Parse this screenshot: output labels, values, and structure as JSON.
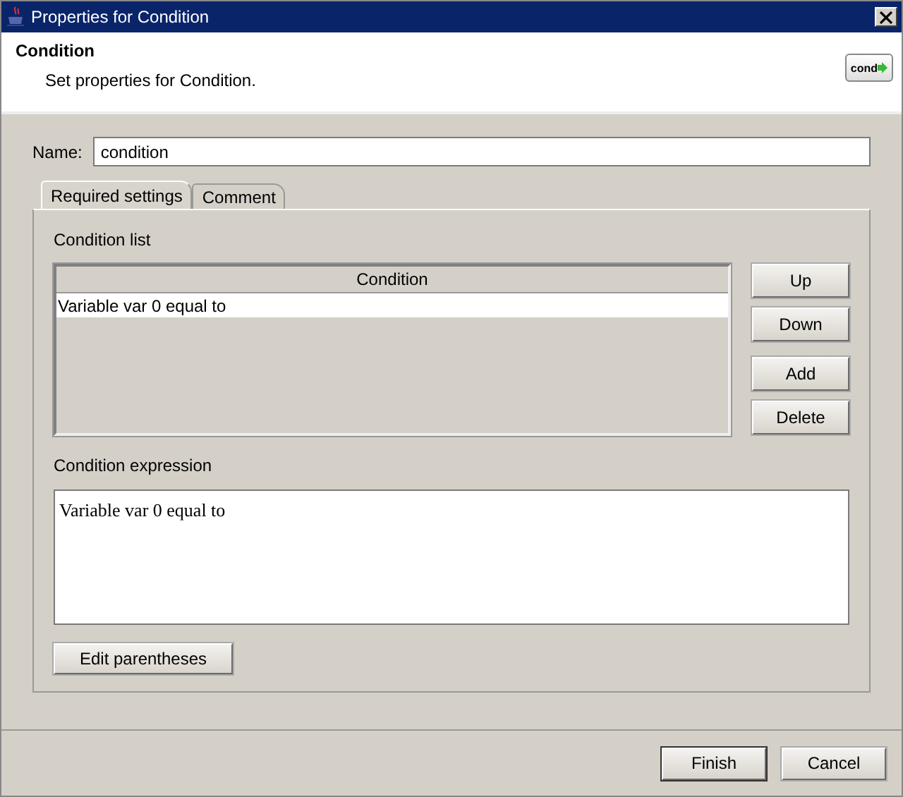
{
  "window": {
    "title": "Properties for Condition"
  },
  "header": {
    "title": "Condition",
    "description": "Set properties for Condition.",
    "badge": "cond"
  },
  "name_field": {
    "label": "Name:",
    "value": "condition"
  },
  "tabs": [
    {
      "label": "Required settings",
      "selected": true
    },
    {
      "label": "Comment",
      "selected": false
    }
  ],
  "condition_list": {
    "label": "Condition list",
    "columns": [
      "Condition"
    ],
    "rows": [
      {
        "cells": [
          "Variable var  0 equal to"
        ],
        "selected": true
      }
    ]
  },
  "list_button_groups": [
    [
      "Up",
      "Down"
    ],
    [
      "Add",
      "Delete"
    ]
  ],
  "expression": {
    "label": "Condition expression",
    "value": "Variable var 0 equal to"
  },
  "edit_button": "Edit parentheses",
  "footer_buttons": [
    {
      "label": "Finish",
      "default": true
    },
    {
      "label": "Cancel",
      "default": false
    }
  ]
}
